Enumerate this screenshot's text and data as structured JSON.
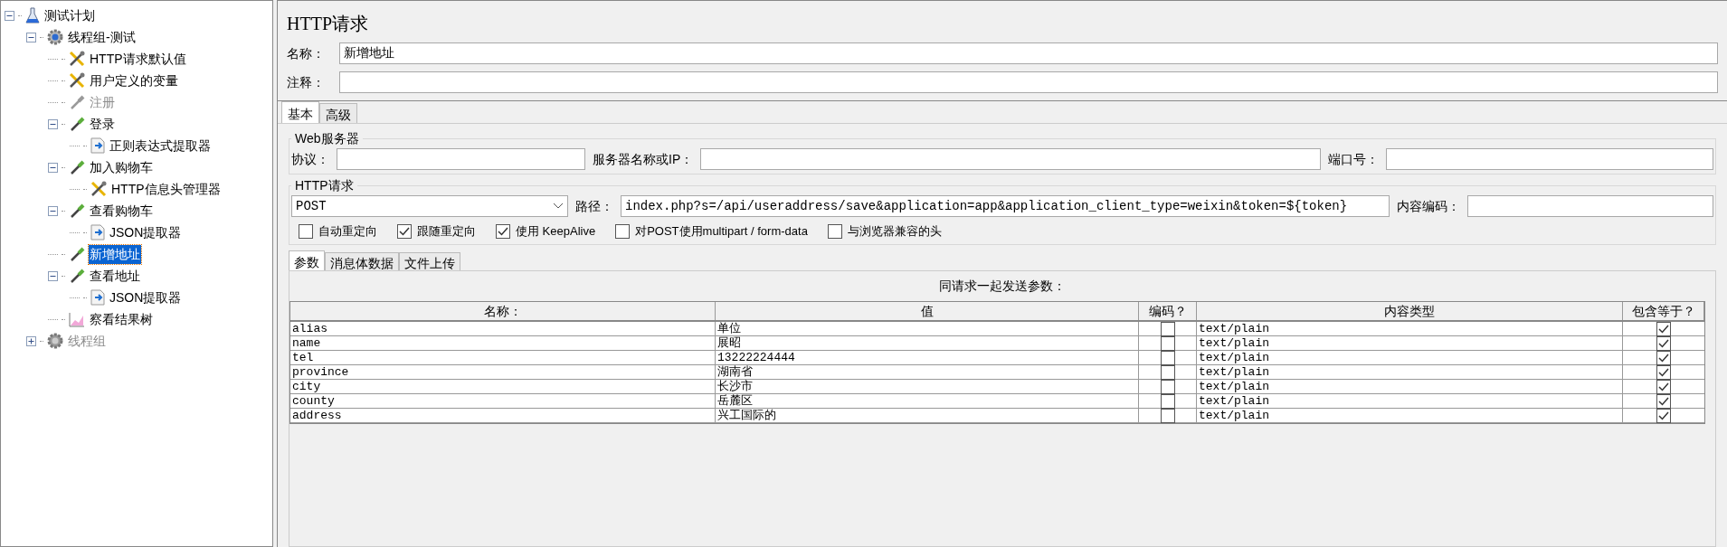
{
  "tree": [
    {
      "label": "测试计划",
      "kind": "plan",
      "expanded": true,
      "disabled": false,
      "selected": false,
      "children": [
        {
          "label": "线程组-测试",
          "kind": "threadgroup",
          "expanded": true,
          "disabled": false,
          "selected": false,
          "children": [
            {
              "label": "HTTP请求默认值",
              "kind": "config",
              "disabled": false,
              "selected": false
            },
            {
              "label": "用户定义的变量",
              "kind": "config",
              "disabled": false,
              "selected": false
            },
            {
              "label": "注册",
              "kind": "sampler",
              "disabled": true,
              "selected": false
            },
            {
              "label": "登录",
              "kind": "sampler",
              "expanded": true,
              "disabled": false,
              "selected": false,
              "children": [
                {
                  "label": "正则表达式提取器",
                  "kind": "extractor",
                  "disabled": false,
                  "selected": false
                }
              ]
            },
            {
              "label": "加入购物车",
              "kind": "sampler",
              "expanded": true,
              "disabled": false,
              "selected": false,
              "children": [
                {
                  "label": "HTTP信息头管理器",
                  "kind": "config",
                  "disabled": false,
                  "selected": false
                }
              ]
            },
            {
              "label": "查看购物车",
              "kind": "sampler",
              "expanded": true,
              "disabled": false,
              "selected": false,
              "children": [
                {
                  "label": "JSON提取器",
                  "kind": "extractor",
                  "disabled": false,
                  "selected": false
                }
              ]
            },
            {
              "label": "新增地址",
              "kind": "sampler",
              "disabled": false,
              "selected": true
            },
            {
              "label": "查看地址",
              "kind": "sampler",
              "expanded": true,
              "disabled": false,
              "selected": false,
              "children": [
                {
                  "label": "JSON提取器",
                  "kind": "extractor",
                  "disabled": false,
                  "selected": false
                }
              ]
            },
            {
              "label": "察看结果树",
              "kind": "listener",
              "disabled": false,
              "selected": false
            }
          ]
        },
        {
          "label": "线程组",
          "kind": "threadgroup",
          "expanded": false,
          "disabled": true,
          "selected": false
        }
      ]
    }
  ],
  "panel": {
    "title": "HTTP请求",
    "name_label": "名称：",
    "name_value": "新增地址",
    "comment_label": "注释："
  },
  "tabs": [
    {
      "label": "基本",
      "selected": true
    },
    {
      "label": "高级",
      "selected": false
    }
  ],
  "web_server": {
    "title": "Web服务器",
    "protocol_label": "协议：",
    "server_label": "服务器名称或IP：",
    "port_label": "端口号："
  },
  "http_request": {
    "title": "HTTP请求",
    "method": "POST",
    "path_label": "路径：",
    "path": "index.php?s=/api/useraddress/save&application=app&application_client_type=weixin&token=${token}",
    "encoding_label": "内容编码：",
    "options": [
      {
        "label": "自动重定向",
        "checked": false
      },
      {
        "label": "跟随重定向",
        "checked": true
      },
      {
        "label": "使用 KeepAlive",
        "checked": true
      },
      {
        "label": "对POST使用multipart / form-data",
        "checked": false
      },
      {
        "label": "与浏览器兼容的头",
        "checked": false
      }
    ]
  },
  "sub_tabs": [
    {
      "label": "参数",
      "selected": true
    },
    {
      "label": "消息体数据",
      "selected": false
    },
    {
      "label": "文件上传",
      "selected": false
    }
  ],
  "parameters": {
    "caption": "同请求一起发送参数：",
    "columns": [
      "名称：",
      "值",
      "编码？",
      "内容类型",
      "包含等于？"
    ],
    "rows": [
      {
        "name": "alias",
        "value": "单位",
        "encode": false,
        "content_type": "text/plain",
        "include_equals": true
      },
      {
        "name": "name",
        "value": "展昭",
        "encode": false,
        "content_type": "text/plain",
        "include_equals": true
      },
      {
        "name": "tel",
        "value": "13222224444",
        "encode": false,
        "content_type": "text/plain",
        "include_equals": true
      },
      {
        "name": "province",
        "value": "湖南省",
        "encode": false,
        "content_type": "text/plain",
        "include_equals": true
      },
      {
        "name": "city",
        "value": "长沙市",
        "encode": false,
        "content_type": "text/plain",
        "include_equals": true
      },
      {
        "name": "county",
        "value": "岳麓区",
        "encode": false,
        "content_type": "text/plain",
        "include_equals": true
      },
      {
        "name": "address",
        "value": "兴工国际的",
        "encode": false,
        "content_type": "text/plain",
        "include_equals": true
      }
    ]
  }
}
